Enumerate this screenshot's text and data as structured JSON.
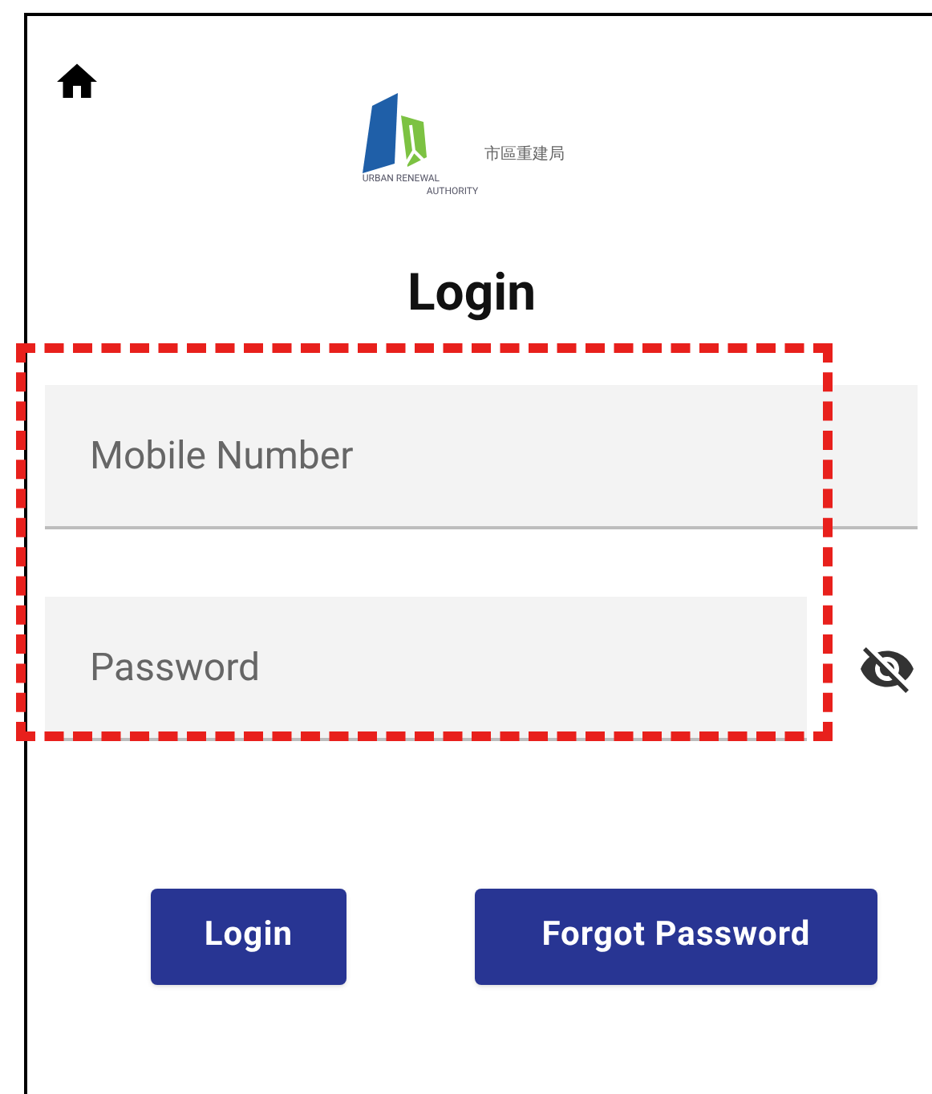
{
  "logo": {
    "chinese_name": "市區重建局",
    "english_line_1": "URBAN RENEWAL",
    "english_line_2": "AUTHORITY"
  },
  "title": "Login",
  "fields_highlighted": true,
  "fields": [
    {
      "placeholder": "Mobile Number",
      "kind": "text"
    },
    {
      "placeholder": "Password",
      "kind": "password"
    }
  ],
  "buttons": [
    "Login",
    "Forgot Password"
  ]
}
